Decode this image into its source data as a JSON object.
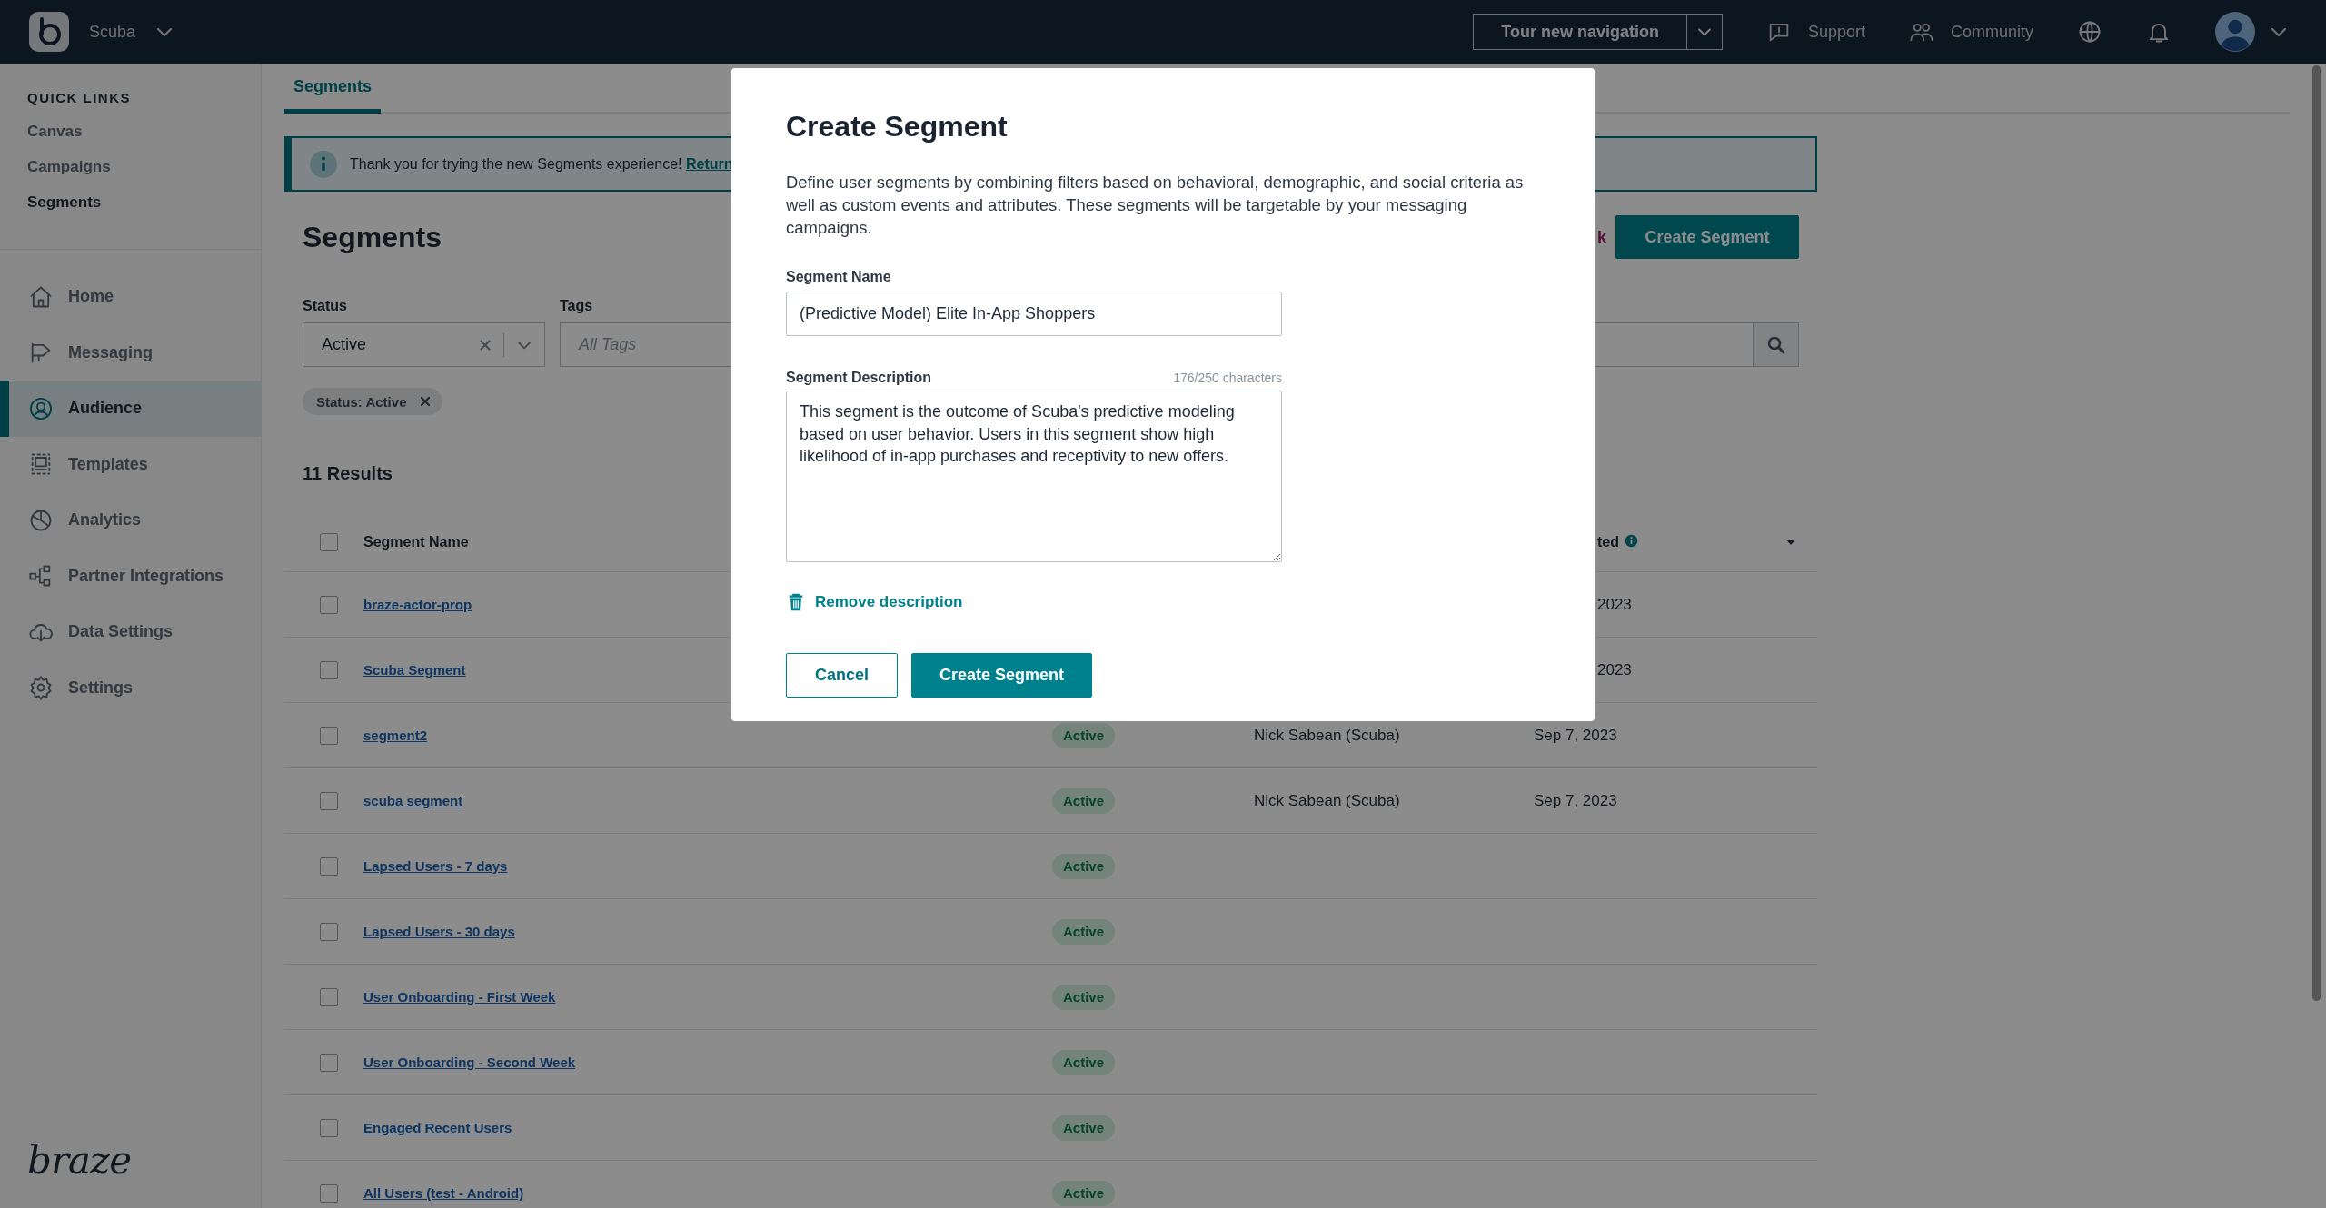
{
  "top_bar": {
    "workspace": "Scuba",
    "tour_button": "Tour new navigation",
    "links": [
      {
        "label": "Support"
      },
      {
        "label": "Community"
      }
    ]
  },
  "sidebar": {
    "quick_links_title": "QUICK LINKS",
    "quick_links": [
      {
        "label": "Canvas",
        "selected": false
      },
      {
        "label": "Campaigns",
        "selected": false
      },
      {
        "label": "Segments",
        "selected": true
      }
    ],
    "nav": [
      {
        "label": "Home",
        "selected": false
      },
      {
        "label": "Messaging",
        "selected": false
      },
      {
        "label": "Audience",
        "selected": true
      },
      {
        "label": "Templates",
        "selected": false
      },
      {
        "label": "Analytics",
        "selected": false
      },
      {
        "label": "Partner Integrations",
        "selected": false
      },
      {
        "label": "Data Settings",
        "selected": false
      },
      {
        "label": "Settings",
        "selected": false
      }
    ],
    "logo": "braze"
  },
  "tabs": [
    {
      "label": "Segments",
      "selected": true
    }
  ],
  "banner": {
    "text": "Thank you for trying the new Segments experience!",
    "link": "Return"
  },
  "page_title": "Segments",
  "header_link": "k",
  "create_button": "Create Segment",
  "filters": {
    "status_label": "Status",
    "status_value": "Active",
    "tags_label": "Tags",
    "tags_placeholder": "All Tags"
  },
  "active_filters": [
    {
      "label": "Status: Active"
    }
  ],
  "results_count": "11 Results",
  "table": {
    "header": {
      "checked": false,
      "name": "Segment Name",
      "column_4": "ted"
    },
    "rows": [
      {
        "checked": false,
        "name": "braze-actor-prop",
        "column_4": "2023"
      },
      {
        "checked": false,
        "name": "Scuba Segment",
        "column_4": "2023"
      },
      {
        "checked": false,
        "name": "segment2",
        "column_2": "Active",
        "column_3": "Nick Sabean (Scuba)",
        "column_4": "Sep 7, 2023"
      },
      {
        "checked": false,
        "name": "scuba segment",
        "column_2": "Active",
        "column_3": "Nick Sabean (Scuba)",
        "column_4": "Sep 7, 2023"
      },
      {
        "checked": false,
        "name": "Lapsed Users - 7 days",
        "column_2": "Active"
      },
      {
        "checked": false,
        "name": "Lapsed Users - 30 days",
        "column_2": "Active"
      },
      {
        "checked": false,
        "name": "User Onboarding - First Week",
        "column_2": "Active"
      },
      {
        "checked": false,
        "name": "User Onboarding - Second Week",
        "column_2": "Active"
      },
      {
        "checked": false,
        "name": "Engaged Recent Users",
        "column_2": "Active"
      },
      {
        "checked": false,
        "name": "All Users (test - Android)",
        "column_2": "Active"
      }
    ]
  },
  "modal": {
    "title": "Create Segment",
    "description": "Define user segments by combining filters based on behavioral, demographic, and social criteria as well as custom events and attributes. These segments will be targetable by your messaging campaigns.",
    "name_label": "Segment Name",
    "name_value": "(Predictive Model) Elite In-App Shoppers",
    "description_label": "Segment Description",
    "char_count": "176/250 characters",
    "description_value": "This segment is the outcome of Scuba's predictive modeling based on user behavior. Users in this segment show high likelihood of in-app purchases and receptivity to new offers.",
    "remove_link": "Remove description",
    "buttons": [
      {
        "label": "Cancel",
        "kind": "secondary"
      },
      {
        "label": "Create Segment",
        "kind": "primary"
      }
    ]
  }
}
